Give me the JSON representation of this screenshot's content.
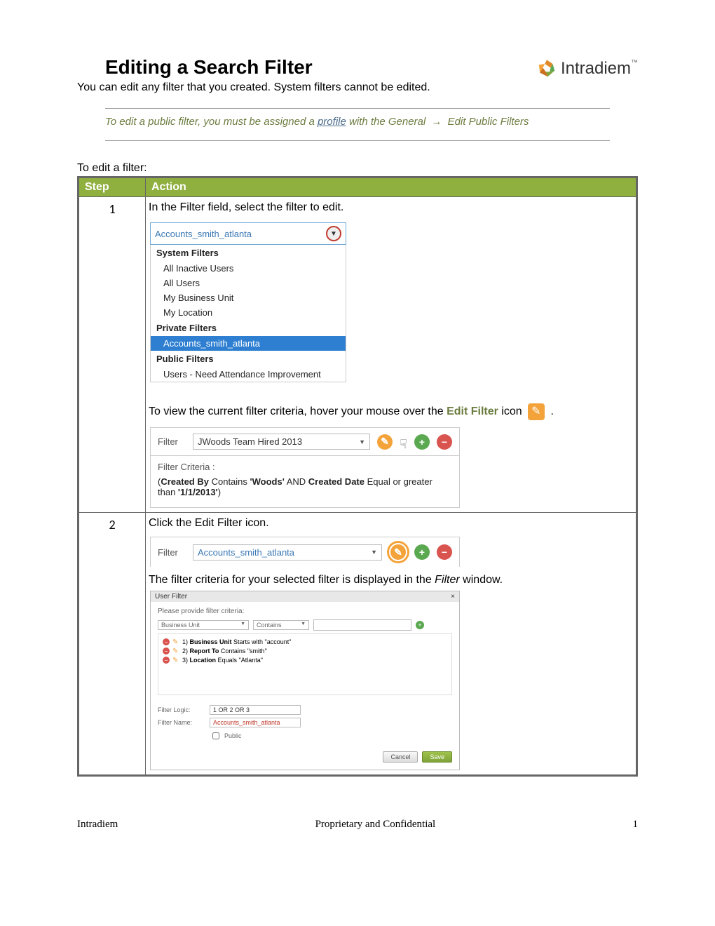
{
  "header": {
    "title": "Editing a Search Filter",
    "brand": "Intradiem",
    "tm": "™"
  },
  "intro": "You can edit any filter that you created. System filters cannot be edited.",
  "note": {
    "pre": "To edit a public filter, you must be assigned a ",
    "link": "profile",
    "mid": " with the General ",
    "arrow": "→",
    "post": " Edit Public Filters"
  },
  "table": {
    "head_step": "Step",
    "head_action": "Action",
    "row1": {
      "num": "1",
      "line1": "In the Filter field, select the filter to edit.",
      "dropdown": {
        "selected": "Accounts_smith_atlanta",
        "h1": "System Filters",
        "i1": "All Inactive Users",
        "i2": "All Users",
        "i3": "My Business Unit",
        "i4": "My Location",
        "h2": "Private Filters",
        "i5": "Accounts_smith_atlanta",
        "h3": "Public Filters",
        "i6": "Users - Need Attendance Improvement"
      },
      "line2_pre": "To view the current filter criteria, hover your mouse over the ",
      "line2_bold": "Edit Filter",
      "line2_post": " icon ",
      "line2_end": " .",
      "filterbar": {
        "label": "Filter",
        "value": "JWoods Team Hired 2013",
        "criteria_label": "Filter Criteria :",
        "criteria_html_prefix": "(",
        "cb": "Created By",
        "contains": " Contains ",
        "woods": "'Woods'",
        "and": " AND  ",
        "cd": "Created Date",
        "eq": " Equal or greater than ",
        "date": "'1/1/2013'",
        "suffix": ")"
      }
    },
    "row2": {
      "num": "2",
      "line1": "Click the Edit Filter icon.",
      "filterbar": {
        "label": "Filter",
        "value": "Accounts_smith_atlanta"
      },
      "line2_pre": "The filter criteria for your selected filter is displayed in the ",
      "line2_italic": "Filter",
      "line2_post": " window.",
      "userfilter": {
        "title": "User Filter",
        "close": "×",
        "instr": "Please provide filter criteria:",
        "field": "Business Unit",
        "op": "Contains",
        "r1_pre": "1)  ",
        "r1_b": "Business Unit",
        "r1_post": " Starts with \"account\"",
        "r2_pre": "2)  ",
        "r2_b": "Report To",
        "r2_post": " Contains \"smith\"",
        "r3_pre": "3)  ",
        "r3_b": "Location",
        "r3_post": " Equals \"Atlanta\"",
        "logic_label": "Filter Logic:",
        "logic_val": "1 OR 2 OR 3",
        "name_label": "Filter Name:",
        "name_val": "Accounts_smith_atlanta",
        "public": "Public",
        "cancel": "Cancel",
        "save": "Save"
      }
    }
  },
  "footer": {
    "left": "Intradiem",
    "center": "Proprietary and Confidential",
    "right": "1"
  }
}
